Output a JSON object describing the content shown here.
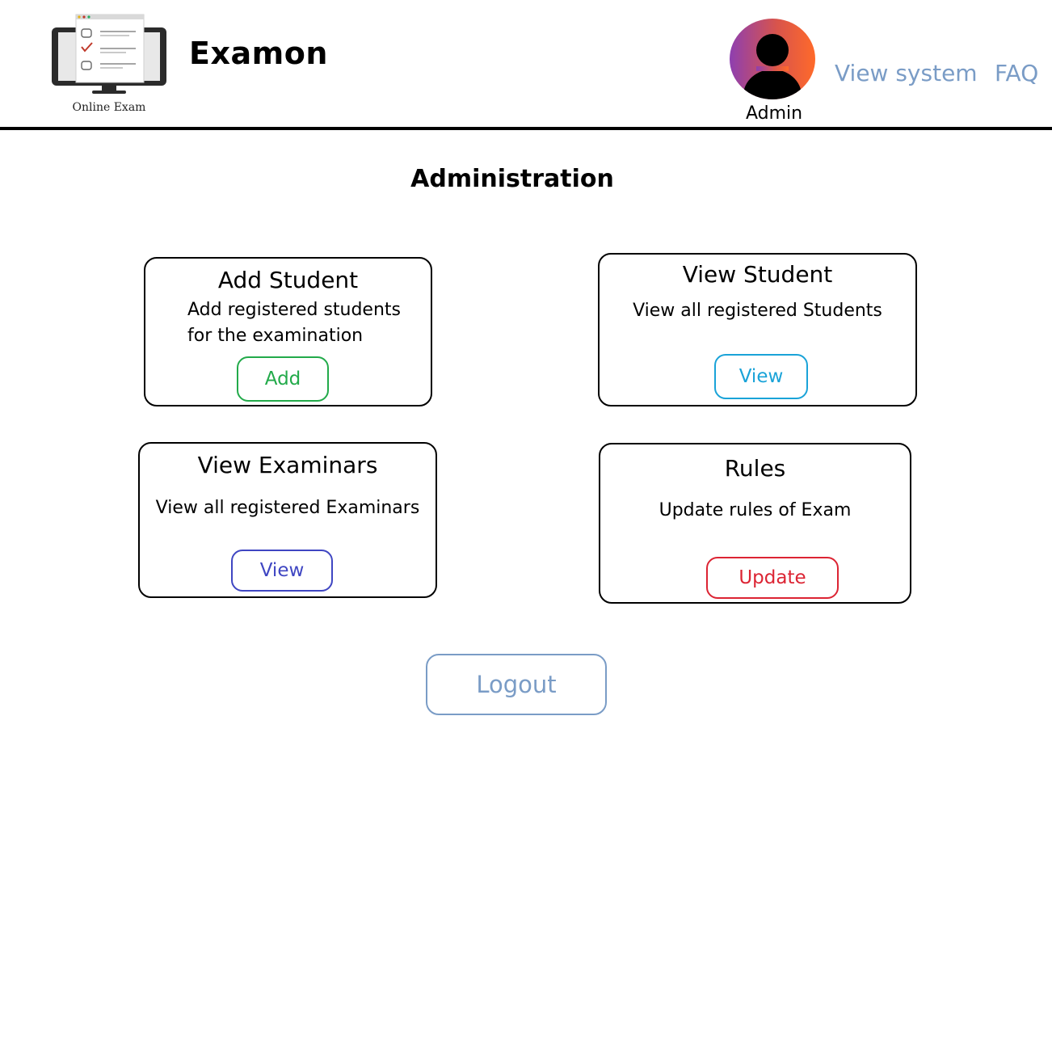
{
  "header": {
    "logo_caption": "Online Exam",
    "brand": "Examon",
    "user_label": "Admin",
    "nav": {
      "view_system": "View system",
      "faq": "FAQ"
    }
  },
  "main": {
    "title": "Administration",
    "cards": {
      "add_student": {
        "title": "Add Student",
        "desc_line1": "Add registered students",
        "desc_line2": "for the examination",
        "button": "Add",
        "color": "#22aa4a"
      },
      "view_student": {
        "title": "View Student",
        "desc": "View all registered Students",
        "button": "View",
        "color": "#1aa3d8"
      },
      "view_examinars": {
        "title": "View Examinars",
        "desc": "View all registered Examinars",
        "button": "View",
        "color": "#3f46c2"
      },
      "rules": {
        "title": "Rules",
        "desc": "Update rules of Exam",
        "button": "Update",
        "color": "#dc2433"
      }
    },
    "logout": "Logout"
  },
  "colors": {
    "link": "#7a9cc6",
    "text": "#000000"
  }
}
